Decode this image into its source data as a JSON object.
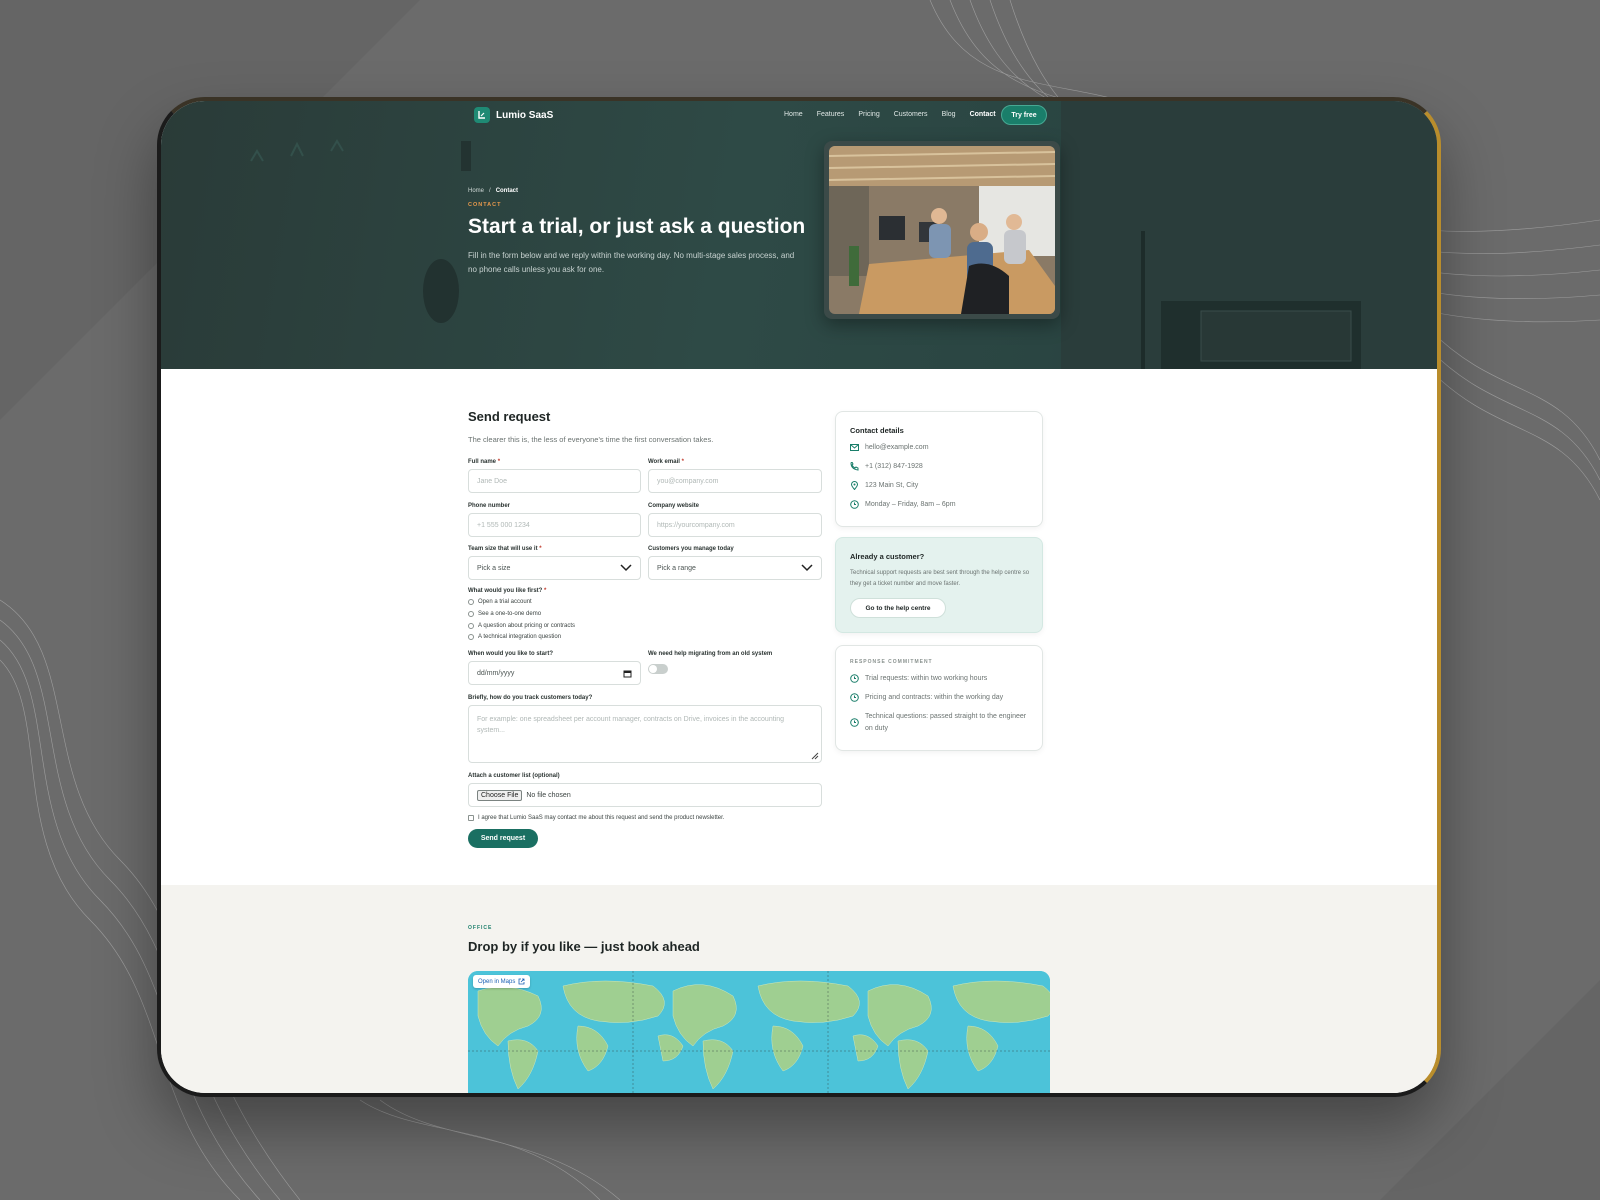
{
  "brand": {
    "name": "Lumio SaaS"
  },
  "nav": {
    "links": [
      "Home",
      "Features",
      "Pricing",
      "Customers",
      "Blog",
      "Contact"
    ],
    "active": "Contact",
    "cta": "Try free"
  },
  "hero": {
    "breadcrumb": [
      "Home",
      "/",
      "Contact"
    ],
    "eyebrow": "CONTACT",
    "title": "Start a trial, or just ask a question",
    "subtitle": "Fill in the form below and we reply within the working day. No multi-stage sales process, and no phone calls unless you ask for one."
  },
  "form": {
    "title": "Send request",
    "subtitle": "The clearer this is, the less of everyone's time the first conversation takes.",
    "full_name": {
      "label": "Full name",
      "placeholder": "Jane Doe"
    },
    "work_email": {
      "label": "Work email",
      "placeholder": "you@company.com"
    },
    "phone": {
      "label": "Phone number",
      "placeholder": "+1 555 000 1234"
    },
    "website": {
      "label": "Company website",
      "placeholder": "https://yourcompany.com"
    },
    "team_size": {
      "label": "Team size that will use it",
      "value": "Pick a size"
    },
    "customers": {
      "label": "Customers you manage today",
      "value": "Pick a range"
    },
    "first": {
      "label": "What would you like first?",
      "options": [
        "Open a trial account",
        "See a one-to-one demo",
        "A question about pricing or contracts",
        "A technical integration question"
      ]
    },
    "start": {
      "label": "When would you like to start?",
      "placeholder": "dd/mm/yyyy"
    },
    "migrating": {
      "label": "We need help migrating from an old system"
    },
    "tracking": {
      "label": "Briefly, how do you track customers today?",
      "placeholder": "For example: one spreadsheet per account manager, contracts on Drive, invoices in the accounting system..."
    },
    "attach": {
      "label": "Attach a customer list (optional)",
      "button": "Choose File",
      "status": "No file chosen"
    },
    "agree": "I agree that Lumio SaaS may contact me about this request and send the product newsletter.",
    "submit": "Send request"
  },
  "contact_card": {
    "title": "Contact details",
    "email": "hello@example.com",
    "phone": "+1 (312) 847-1928",
    "address": "123 Main St, City",
    "hours": "Monday – Friday, 8am – 6pm"
  },
  "customer_card": {
    "title": "Already a customer?",
    "text": "Technical support requests are best sent through the help centre so they get a ticket number and move faster.",
    "button": "Go to the help centre"
  },
  "commitment_card": {
    "eyebrow": "RESPONSE COMMITMENT",
    "items": [
      "Trial requests: within two working hours",
      "Pricing and contracts: within the working day",
      "Technical questions: passed straight to the engineer on duty"
    ]
  },
  "office": {
    "eyebrow": "OFFICE",
    "title": "Drop by if you like — just book ahead",
    "map_link": "Open in Maps"
  },
  "colors": {
    "accent": "#1a7e6a",
    "hero_bg": "#2e4a46",
    "eyebrow": "#e89a4c",
    "frame_border": "#b98d2c"
  }
}
